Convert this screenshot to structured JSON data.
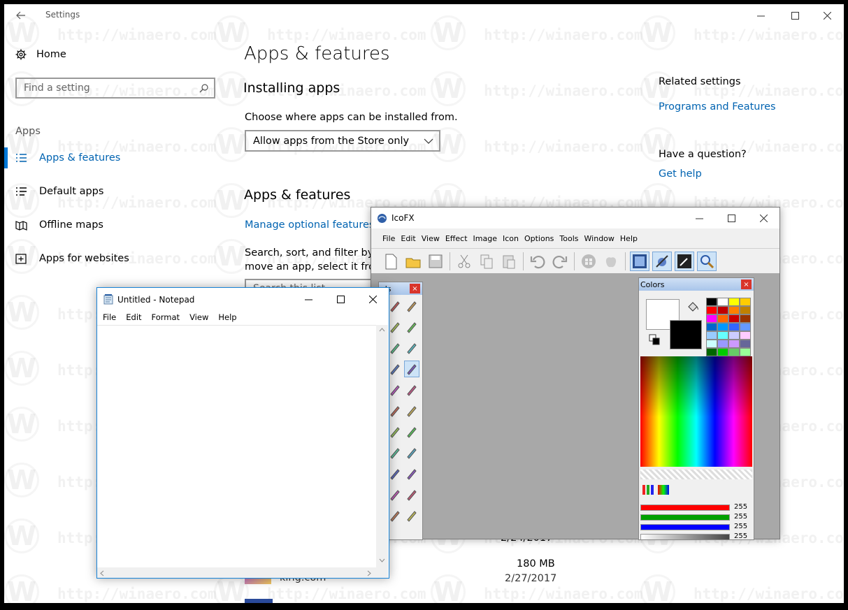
{
  "settings": {
    "title": "Settings",
    "home_label": "Home",
    "search_placeholder": "Find a setting",
    "section_label": "Apps",
    "nav": [
      {
        "label": "Apps & features",
        "icon": "list-icon",
        "selected": true
      },
      {
        "label": "Default apps",
        "icon": "list-check-icon",
        "selected": false
      },
      {
        "label": "Offline maps",
        "icon": "map-icon",
        "selected": false
      },
      {
        "label": "Apps for websites",
        "icon": "window-link-icon",
        "selected": false
      }
    ],
    "page_title": "Apps & features",
    "installing_heading": "Installing apps",
    "choose_label": "Choose where apps can be installed from.",
    "install_source_value": "Allow apps from the Store only",
    "apps_heading": "Apps & features",
    "manage_link": "Manage optional features",
    "search_desc_line1": "Search, sort, and filter by dr",
    "search_desc_line2": "move an app, select it from",
    "search_list_placeholder": "Search this list",
    "related_heading": "Related settings",
    "programs_link": "Programs and Features",
    "question_heading": "Have a question?",
    "help_link": "Get help",
    "app_entry": {
      "publisher": "king.com",
      "size": "180 MB",
      "date": "2/27/2017",
      "partial_date": "2/24/2017"
    },
    "accent_color": "#0078d7",
    "watermark": "http://winaero.com"
  },
  "icofx": {
    "title": "IcoFX",
    "menu": [
      "File",
      "Edit",
      "View",
      "Effect",
      "Image",
      "Icon",
      "Options",
      "Tools",
      "Window",
      "Help"
    ],
    "toolbar_icons": [
      "new-file-icon",
      "open-folder-icon",
      "save-icon",
      "cut-icon",
      "copy-icon",
      "paste-icon",
      "undo-icon",
      "redo-icon",
      "windows-logo-icon",
      "apple-logo-icon",
      "icon-editor-icon",
      "extract-icon",
      "screen-capture-icon",
      "zoom-icon"
    ],
    "tools_panel_title": "ols",
    "colors_panel_title": "Colors",
    "rgb": [
      {
        "channel": "red",
        "value": "255",
        "color": "#ff0000"
      },
      {
        "channel": "green",
        "value": "255",
        "color": "#00a000"
      },
      {
        "channel": "blue",
        "value": "255",
        "color": "#0000ff"
      },
      {
        "channel": "alpha",
        "value": "255",
        "color": "#808080"
      }
    ],
    "palette": [
      "#000000",
      "#ffffff",
      "#ffff00",
      "#ffcc00",
      "#ff0000",
      "#c00000",
      "#ff8000",
      "#c08000",
      "#ff00ff",
      "#ff6600",
      "#cc0000",
      "#993300",
      "#0066cc",
      "#0099ff",
      "#3366ff",
      "#6699ff",
      "#99ccff",
      "#66ffff",
      "#ccccff",
      "#ffccff",
      "#ccffff",
      "#9999ff",
      "#cc99ff",
      "#666699",
      "#006600",
      "#00cc00",
      "#66cc66",
      "#99ff99"
    ]
  },
  "notepad": {
    "title": "Untitled - Notepad",
    "menu": [
      "File",
      "Edit",
      "Format",
      "View",
      "Help"
    ],
    "content": ""
  }
}
